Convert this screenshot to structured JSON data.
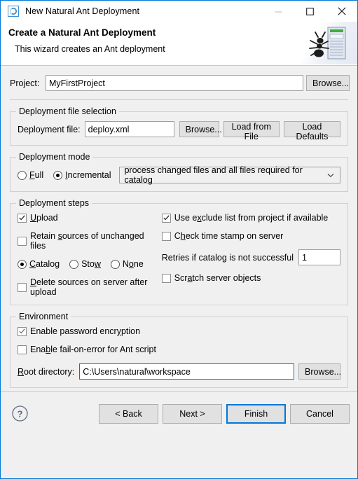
{
  "window": {
    "title": "New Natural Ant Deployment",
    "icon": "natural-app-icon",
    "controls": {
      "minimize": "minimize-icon",
      "maximize": "maximize-icon",
      "close": "close-icon"
    }
  },
  "header": {
    "title": "Create a Natural Ant Deployment",
    "subtitle": "This wizard creates an Ant deployment",
    "art": "ant-server-banner"
  },
  "project": {
    "label": "Project:",
    "value": "MyFirstProject",
    "browse_label": "Browse..."
  },
  "deployment_file": {
    "group_title": "Deployment file selection",
    "label": "Deployment file:",
    "value": "deploy.xml",
    "browse_label": "Browse...",
    "load_from_file_label": "Load from File",
    "load_defaults_label": "Load Defaults"
  },
  "deployment_mode": {
    "group_title": "Deployment mode",
    "options": [
      {
        "label": "Full",
        "mnemonic": "F",
        "selected": false
      },
      {
        "label": "Incremental",
        "mnemonic": "I",
        "selected": true
      }
    ],
    "combo_value": "process changed files and all files required for catalog",
    "combo_arrow": "chevron-down-icon"
  },
  "deployment_steps": {
    "group_title": "Deployment steps",
    "left": {
      "upload": {
        "label": "Upload",
        "checked": true
      },
      "retain_sources": {
        "label": "Retain sources of unchanged files",
        "checked": false
      },
      "radios": [
        {
          "label": "Catalog",
          "selected": true
        },
        {
          "label": "Stow",
          "selected": false
        },
        {
          "label": "None",
          "selected": false
        }
      ],
      "delete_sources": {
        "label": "Delete sources on server after upload",
        "checked": false
      }
    },
    "right": {
      "use_exclude_list": {
        "label": "Use exclude list from project if available",
        "checked": true
      },
      "check_time_stamp": {
        "label": "Check time stamp on server",
        "checked": false
      },
      "retries_label": "Retries if catalog is not successful",
      "retries_value": "1",
      "scratch_server_objects": {
        "label": "Scratch server objects",
        "checked": false
      }
    }
  },
  "environment": {
    "group_title": "Environment",
    "password_encryption": {
      "label": "Enable password encryption",
      "checked": true
    },
    "fail_on_error": {
      "label": "Enable fail-on-error for Ant script",
      "checked": false
    },
    "root_directory": {
      "label": "Root directory:",
      "value": "C:\\Users\\natural\\workspace",
      "browse_label": "Browse...",
      "focused": true
    }
  },
  "footer": {
    "help_icon": "help-icon",
    "back_label": "< Back",
    "next_label": "Next >",
    "finish_label": "Finish",
    "cancel_label": "Cancel"
  },
  "colors": {
    "accent": "#0078d7",
    "dialog_bg": "#f0f0f0",
    "field_bg": "#ffffff"
  }
}
